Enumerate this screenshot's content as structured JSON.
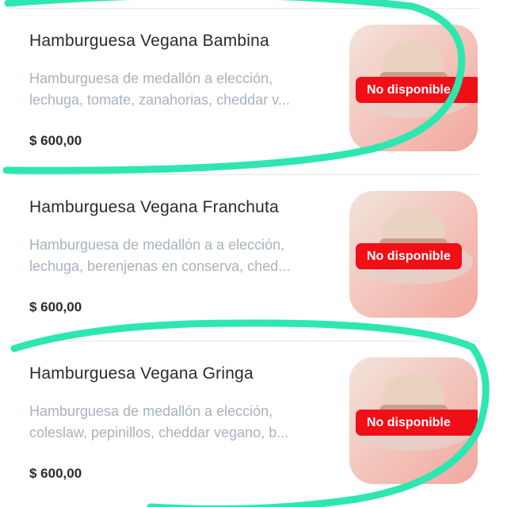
{
  "products": [
    {
      "name": "Hamburguesa Vegana Bambina",
      "desc_line1": "Hamburguesa de medallón a elección,",
      "desc_line2": "lechuga, tomate, zanahorias, cheddar v...",
      "price": "$ 600,00",
      "status": "No disponible"
    },
    {
      "name": "Hamburguesa Vegana Franchuta",
      "desc_line1": "Hamburguesa de medallón a a elección,",
      "desc_line2": "lechuga, berenjenas en conserva, ched...",
      "price": "$ 600,00",
      "status": "No disponible"
    },
    {
      "name": "Hamburguesa Vegana Gringa",
      "desc_line1": "Hamburguesa de medallón a elección,",
      "desc_line2": "coleslaw, pepinillos, cheddar vegano, b...",
      "price": "$ 600,00",
      "status": "No disponible"
    }
  ],
  "colors": {
    "badge": "#f10f17",
    "marker": "#2ee6b0",
    "price_text": "#2b2b2b",
    "description_text": "#a9b2bd"
  }
}
